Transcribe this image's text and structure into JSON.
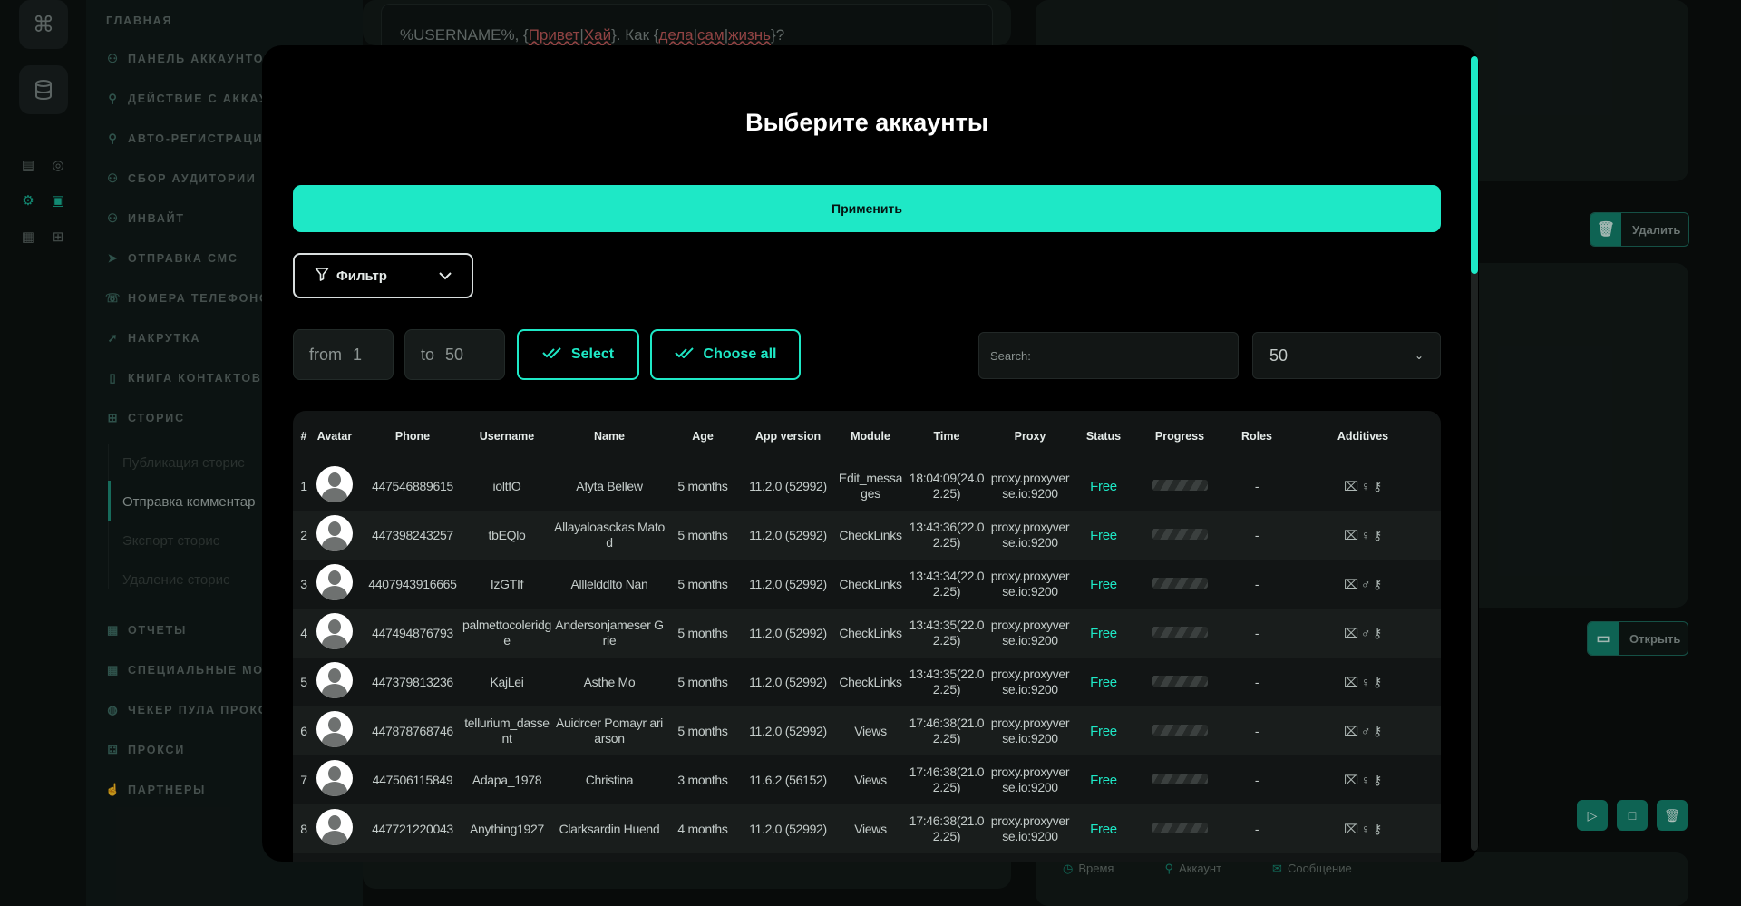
{
  "sidebar": {
    "heading": "ГЛАВНАЯ",
    "items": [
      {
        "label": "ПАНЕЛЬ АККАУНТОВ",
        "icon": "users-icon"
      },
      {
        "label": "ДЕЙСТВИЕ С АККАУ",
        "icon": "user-icon"
      },
      {
        "label": "АВТО-РЕГИСТРАЦИЯ",
        "icon": "user-plus-icon"
      },
      {
        "label": "СБОР АУДИТОРИИ",
        "icon": "user-group-icon"
      },
      {
        "label": "ИНВАЙТ",
        "icon": "invite-icon"
      },
      {
        "label": "ОТПРАВКА СМС",
        "icon": "send-icon"
      },
      {
        "label": "НОМЕРА ТЕЛЕФОНО",
        "icon": "phone-icon"
      },
      {
        "label": "НАКРУТКА",
        "icon": "boost-icon"
      },
      {
        "label": "КНИГА КОНТАКТОВ",
        "icon": "contacts-icon"
      },
      {
        "label": "СТОРИС",
        "icon": "stories-icon"
      }
    ],
    "sub_items": [
      "Публикация сторис",
      "Отправка комментар",
      "Экспорт сторис",
      "Удаление сторис"
    ],
    "items_after": [
      {
        "label": "ОТЧЕТЫ",
        "icon": "reports-icon"
      },
      {
        "label": "СПЕЦИАЛЬНЫЕ МОД",
        "icon": "special-icon"
      },
      {
        "label": "ЧЕКЕР ПУЛА ПРОКС",
        "icon": "checker-icon"
      },
      {
        "label": "ПРОКСИ",
        "icon": "proxy-icon"
      },
      {
        "label": "ПАРТНЕРЫ",
        "icon": "partners-icon"
      }
    ]
  },
  "background": {
    "template_text_pre": "%USERNAME%, {",
    "template_w1": "Привет",
    "template_sep1": "|",
    "template_w2": "Хай",
    "template_mid": "}. Как {",
    "template_w3": "дела",
    "template_sep2": "|",
    "template_w4": "сам",
    "template_sep3": "|",
    "template_w5": "жизнь",
    "template_end": "}?",
    "delete_label": "Удалить",
    "open_label": "Открыть",
    "log_columns": [
      "Время",
      "Аккаунт",
      "Сообщение"
    ]
  },
  "modal": {
    "title": "Выберите аккаунты",
    "apply_label": "Применить",
    "filter_label": "Фильтр",
    "from_label": "from",
    "from_value": "1",
    "to_label": "to",
    "to_value": "50",
    "select_label": "Select",
    "choose_all_label": "Choose all",
    "search_placeholder": "Search:",
    "page_size": "50"
  },
  "table": {
    "headers": [
      "#",
      "Avatar",
      "Phone",
      "Username",
      "Name",
      "Age",
      "App version",
      "Module",
      "Time",
      "Proxy",
      "Status",
      "Progress",
      "Roles",
      "Additives"
    ],
    "rows": [
      {
        "n": "1",
        "phone": "447546889615",
        "username": "ioltfO",
        "name": "Afyta Bellew",
        "age": "5 months",
        "app": "11.2.0 (52992)",
        "module": "Edit_messages",
        "time": "18:04:09(24.02.25)",
        "proxy": "proxy.proxyverse.io:9200",
        "status": "Free",
        "roles": "-",
        "gender": "♀"
      },
      {
        "n": "2",
        "phone": "447398243257",
        "username": "tbEQlo",
        "name": "Allayaloasckas Matod",
        "age": "5 months",
        "app": "11.2.0 (52992)",
        "module": "CheckLinks",
        "time": "13:43:36(22.02.25)",
        "proxy": "proxy.proxyverse.io:9200",
        "status": "Free",
        "roles": "-",
        "gender": "♀"
      },
      {
        "n": "3",
        "phone": "4407943916665",
        "username": "IzGTIf",
        "name": "Alllelddlto Nan",
        "age": "5 months",
        "app": "11.2.0 (52992)",
        "module": "CheckLinks",
        "time": "13:43:34(22.02.25)",
        "proxy": "proxy.proxyverse.io:9200",
        "status": "Free",
        "roles": "-",
        "gender": "♂"
      },
      {
        "n": "4",
        "phone": "447494876793",
        "username": "palmettocoleridge",
        "name": "Andersonjameser Grie",
        "age": "5 months",
        "app": "11.2.0 (52992)",
        "module": "CheckLinks",
        "time": "13:43:35(22.02.25)",
        "proxy": "proxy.proxyverse.io:9200",
        "status": "Free",
        "roles": "-",
        "gender": "♂"
      },
      {
        "n": "5",
        "phone": "447379813236",
        "username": "KajLei",
        "name": "Asthe Mo",
        "age": "5 months",
        "app": "11.2.0 (52992)",
        "module": "CheckLinks",
        "time": "13:43:35(22.02.25)",
        "proxy": "proxy.proxyverse.io:9200",
        "status": "Free",
        "roles": "-",
        "gender": "♀"
      },
      {
        "n": "6",
        "phone": "447878768746",
        "username": "tellurium_dassent",
        "name": "Auidrcer Pomayr ariarson",
        "age": "5 months",
        "app": "11.2.0 (52992)",
        "module": "Views",
        "time": "17:46:38(21.02.25)",
        "proxy": "proxy.proxyverse.io:9200",
        "status": "Free",
        "roles": "-",
        "gender": "♂"
      },
      {
        "n": "7",
        "phone": "447506115849",
        "username": "Adapa_1978",
        "name": "Christina",
        "age": "3 months",
        "app": "11.6.2 (56152)",
        "module": "Views",
        "time": "17:46:38(21.02.25)",
        "proxy": "proxy.proxyverse.io:9200",
        "status": "Free",
        "roles": "-",
        "gender": "♀"
      },
      {
        "n": "8",
        "phone": "447721220043",
        "username": "Anything1927",
        "name": "Clarksardin Huend",
        "age": "4 months",
        "app": "11.2.0 (52992)",
        "module": "Views",
        "time": "17:46:38(21.02.25)",
        "proxy": "proxy.proxyverse.io:9200",
        "status": "Free",
        "roles": "-",
        "gender": "♀"
      }
    ]
  },
  "colors": {
    "accent": "#1ee8c6",
    "accent_dark": "#13856f",
    "modal_bg": "#000000"
  }
}
